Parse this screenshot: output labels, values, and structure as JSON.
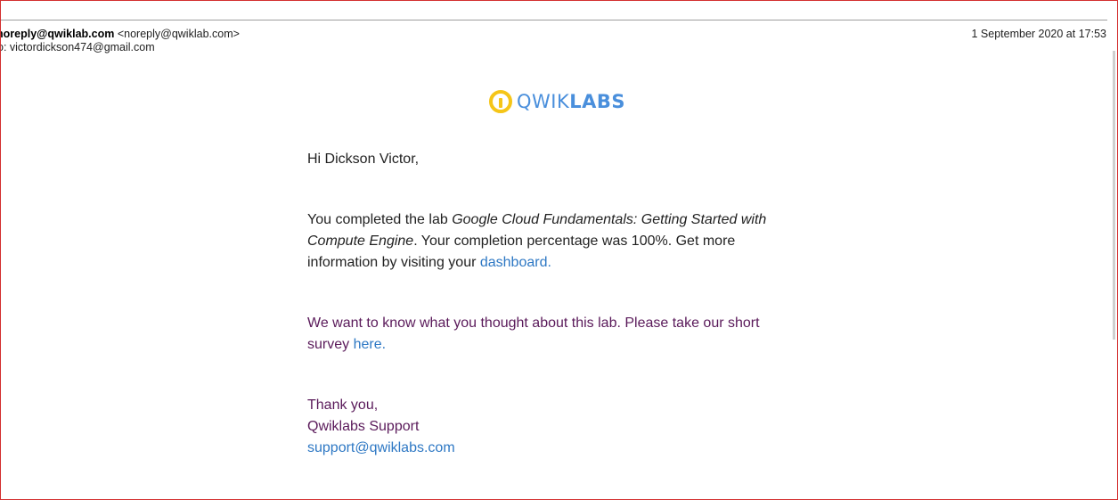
{
  "header": {
    "sender_name": "noreply@qwiklab.com",
    "sender_address": "<noreply@qwiklab.com>",
    "to_line": "o: victordickson474@gmail.com",
    "date": "1 September 2020 at 17:53"
  },
  "logo": {
    "icon": "qwiklabs-logo-icon",
    "text_light": "QWIK",
    "text_bold": "LABS",
    "colors": {
      "mark": "#f5c518",
      "text": "#4a8fdc"
    }
  },
  "email": {
    "greeting": "Hi Dickson Victor,",
    "completed_prefix": "You completed the lab ",
    "lab_name": "Google Cloud Fundamentals: Getting Started with Compute Engine",
    "completed_middle": ". Your completion percentage was 100%. Get more information by visiting your ",
    "dashboard_link": "dashboard.",
    "survey_text": "We want to know what you thought about this lab. Please take our short survey ",
    "survey_link": "here.",
    "thanks": "Thank you,",
    "team": "Qwiklabs Support",
    "support_email": "support@qwiklabs.com"
  },
  "colors": {
    "link": "#2e78c4",
    "purple_text": "#5a1a5a",
    "frame_border": "#d32f2f"
  }
}
